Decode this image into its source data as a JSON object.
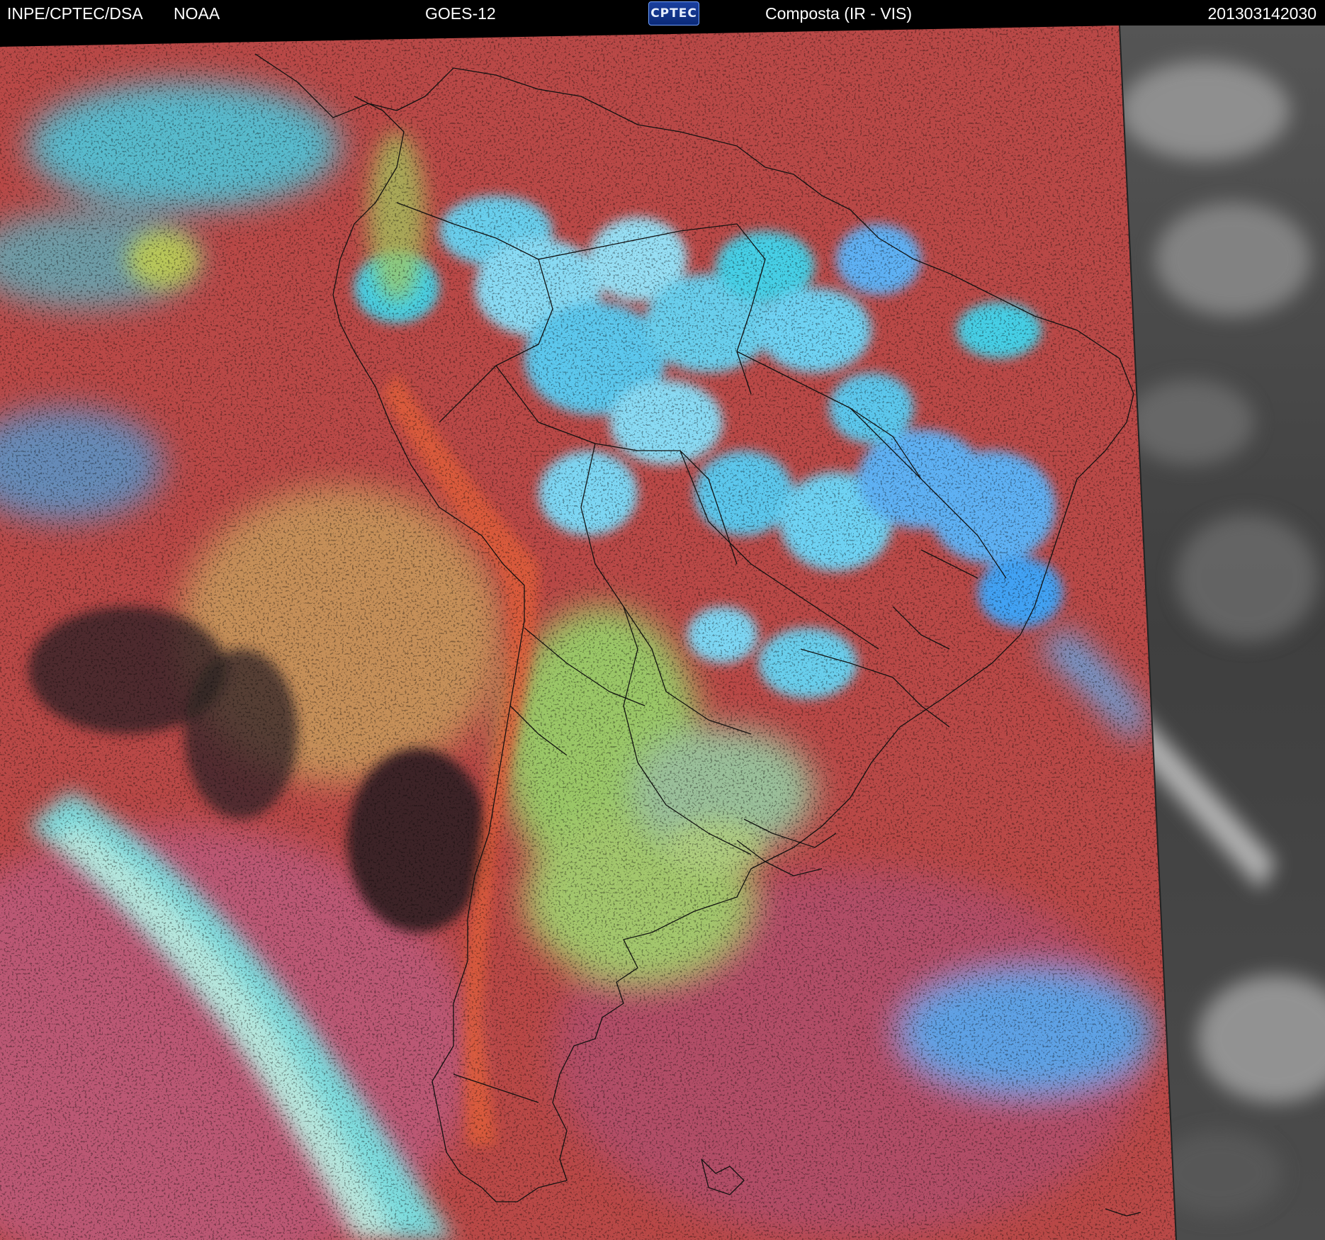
{
  "header": {
    "organization": "INPE/CPTEC/DSA",
    "agency": "NOAA",
    "satellite": "GOES-12",
    "logo_text": "CPTEC",
    "product": "Composta (IR - VIS)",
    "timestamp": "201303142030"
  },
  "colors": {
    "ocean_base": "#c04a48",
    "warm_cloud": "#e8603a",
    "mid_cloud": "#9fd06a",
    "cold_cloud": "#45d8f0",
    "deep_convection": "#5fb8ff",
    "clear_ocean": "#3a2428",
    "pink_marine": "#c25a78",
    "vis_gray": "#4a4a4a"
  },
  "icons": {
    "logo": "cptec-logo-icon"
  }
}
